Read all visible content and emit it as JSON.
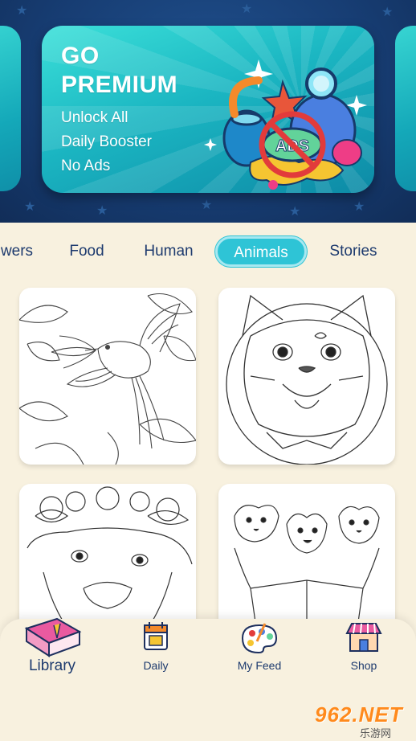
{
  "promo": {
    "title": "GO PREMIUM",
    "lines": [
      "Unlock All",
      "Daily Booster",
      "No Ads"
    ],
    "badge_text": "ADS"
  },
  "categories": [
    "wers",
    "Food",
    "Human",
    "Animals",
    "Stories"
  ],
  "active_category": "Animals",
  "pictures": [
    {
      "subject": "hummingbird-lilies",
      "icon": "hummingbird-picture"
    },
    {
      "subject": "cat-face",
      "icon": "cat-picture"
    },
    {
      "subject": "dog-flower-crown",
      "icon": "dog-picture"
    },
    {
      "subject": "puppies-book",
      "icon": "puppies-picture"
    }
  ],
  "nav": {
    "library": "Library",
    "daily": "Daily",
    "my_feed": "My Feed",
    "shop": "Shop"
  },
  "watermark": {
    "main": "962.NET",
    "sub": "乐游网"
  },
  "colors": {
    "banner_bg": "#173d73",
    "promo_card": "#1bb6c2",
    "active_tab": "#2ec4d6",
    "text_primary": "#1d3a6e",
    "page_bg": "#f8f1df"
  }
}
